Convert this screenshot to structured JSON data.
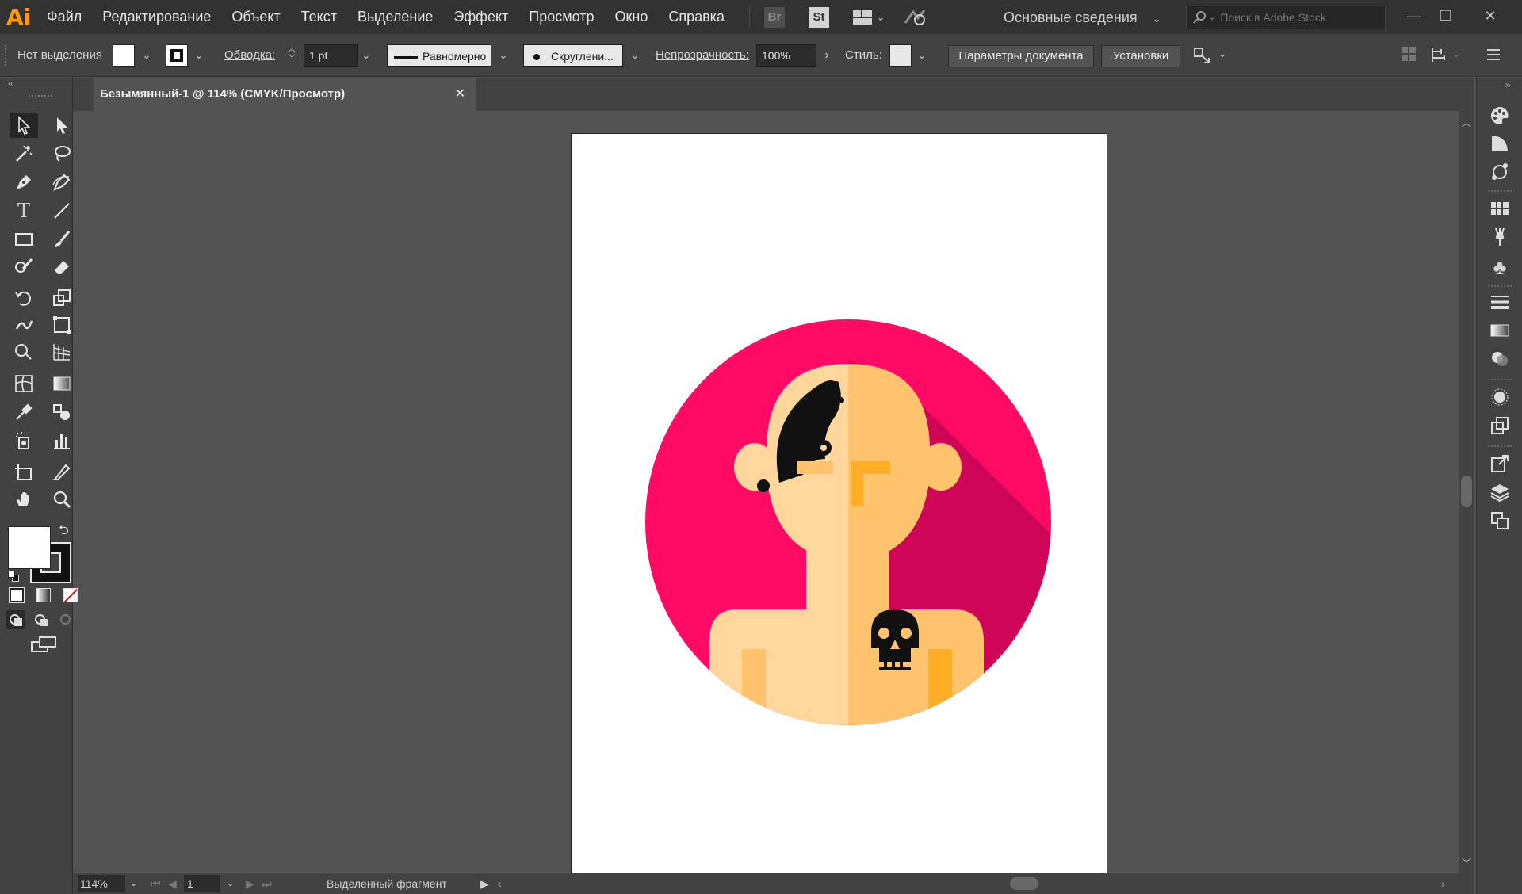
{
  "app": {
    "logo": "Ai",
    "menu": [
      "Файл",
      "Редактирование",
      "Объект",
      "Текст",
      "Выделение",
      "Эффект",
      "Просмотр",
      "Окно",
      "Справка"
    ],
    "badges": [
      "Br",
      "St"
    ],
    "workspace": "Основные сведения",
    "stock_search_placeholder": "Поиск в Adobe Stock"
  },
  "control": {
    "selection": "Нет выделения",
    "stroke_label": "Обводка:",
    "stroke_weight": "1 pt",
    "profile": "Равномерно",
    "brush": "Скруглени...",
    "opacity_label": "Непрозрачность:",
    "opacity_value": "100%",
    "style_label": "Стиль:",
    "doc_setup": "Параметры документа",
    "preferences": "Установки"
  },
  "document": {
    "tab_title": "Безымянный-1 @ 114% (CMYK/Просмотр)"
  },
  "status": {
    "zoom": "114%",
    "artboard": "1",
    "message": "Выделенный фрагмент"
  },
  "colors": {
    "accent": "#ff9a00",
    "circle": "#ff0a65",
    "shadow": "#cf0657",
    "skin_light": "#ffd79c",
    "skin_dark": "#ffc36e",
    "orange": "#ffae27",
    "black": "#111111"
  }
}
